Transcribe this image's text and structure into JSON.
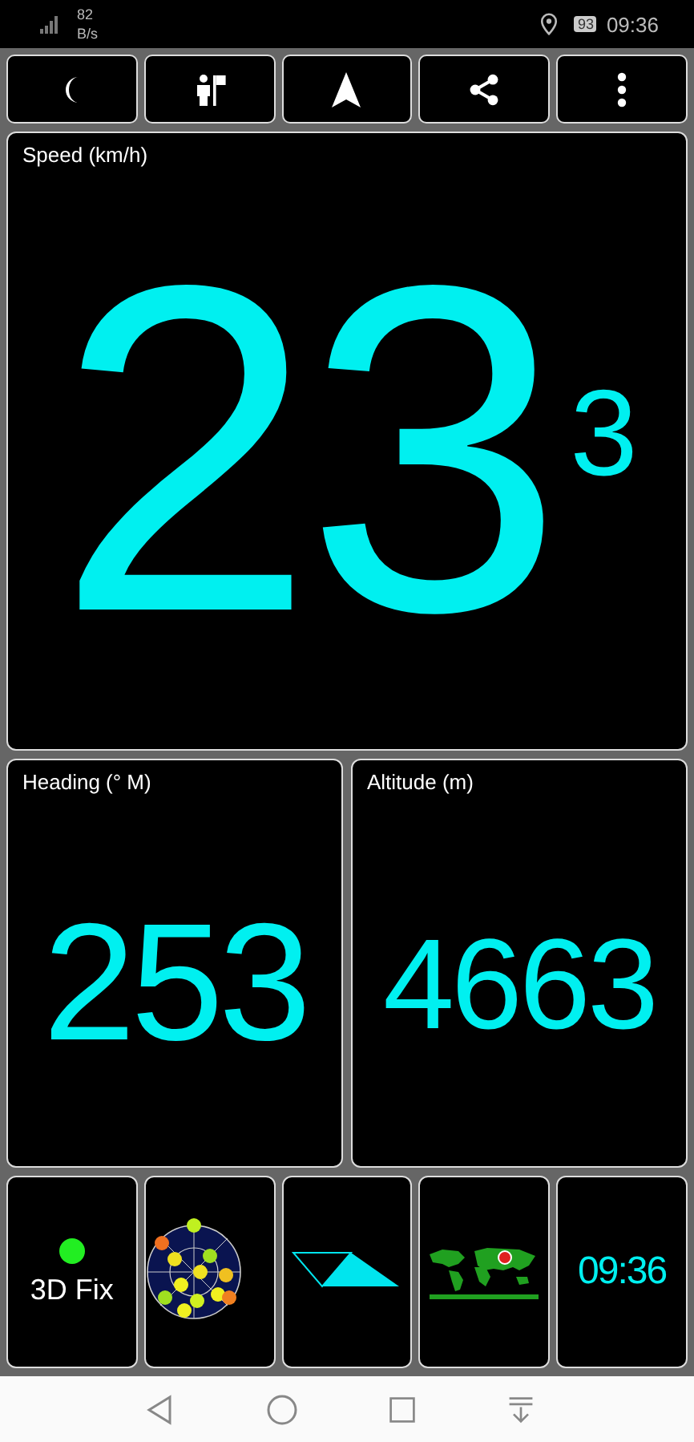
{
  "status_bar": {
    "network_speed": "82",
    "network_unit": "B/s",
    "battery": "93",
    "time": "09:36"
  },
  "speed": {
    "label": "Speed (km/h)",
    "value": "23",
    "decimal": "3"
  },
  "heading": {
    "label": "Heading (° M)",
    "value": "253"
  },
  "altitude": {
    "label": "Altitude (m)",
    "value": "4663"
  },
  "fix": {
    "label": "3D Fix",
    "color": "#22ee22"
  },
  "clock": {
    "time": "09:36"
  }
}
